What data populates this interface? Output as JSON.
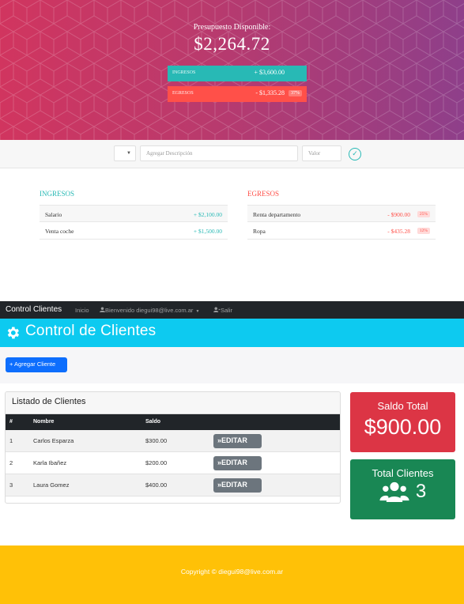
{
  "budget": {
    "title": "Presupuesto Disponible:",
    "value": "$2,264.72",
    "income": {
      "label": "INGRESOS",
      "value": "+ $3,600.00"
    },
    "expense": {
      "label": "EGRESOS",
      "value": "- $1,335.28",
      "percent": "37%"
    }
  },
  "add_form": {
    "desc_placeholder": "Agregar Descripción",
    "value_placeholder": "Valor"
  },
  "income_list": {
    "title": "INGRESOS",
    "items": [
      {
        "desc": "Salario",
        "amount": "+ $2,100.00"
      },
      {
        "desc": "Venta coche",
        "amount": "+ $1,500.00"
      }
    ]
  },
  "expense_list": {
    "title": "EGRESOS",
    "items": [
      {
        "desc": "Renta departamento",
        "amount": "- $900.00",
        "percent": "25%"
      },
      {
        "desc": "Ropa",
        "amount": "- $435.28",
        "percent": "12%"
      }
    ]
  },
  "navbar": {
    "brand": "Control Clientes",
    "home": "Inicio",
    "user": "Bienvenido diegui98@live.com.ar",
    "logout": "Salir"
  },
  "header": {
    "title": "Control de Clientes"
  },
  "actions": {
    "add_client": "+ Agregar Cliente"
  },
  "clients": {
    "card_title": "Listado de Clientes",
    "columns": [
      "#",
      "Nombre",
      "Saldo"
    ],
    "rows": [
      {
        "num": "1",
        "name": "Carlos Esparza",
        "balance": "$300.00",
        "action": "»EDITAR"
      },
      {
        "num": "2",
        "name": "Karla Ibañez",
        "balance": "$200.00",
        "action": "»EDITAR"
      },
      {
        "num": "3",
        "name": "Laura Gomez",
        "balance": "$400.00",
        "action": "»EDITAR"
      }
    ]
  },
  "stats": {
    "saldo_title": "Saldo Total",
    "saldo_value": "$900.00",
    "clients_title": "Total Clientes",
    "clients_value": "3"
  },
  "footer": {
    "copyright": "Copyright © diegui98@live.com.ar"
  },
  "colors": {
    "income": "#28b9b5",
    "expense": "#ff5049",
    "navbar": "#212529",
    "header": "#0dcaf0",
    "primary": "#0d6efd",
    "danger": "#dc3545",
    "success": "#198754",
    "footer": "#ffc107"
  },
  "icons": [
    "check-icon",
    "user-icon",
    "user-logout-icon",
    "gear-icon",
    "users-icon",
    "caret-down-icon"
  ]
}
